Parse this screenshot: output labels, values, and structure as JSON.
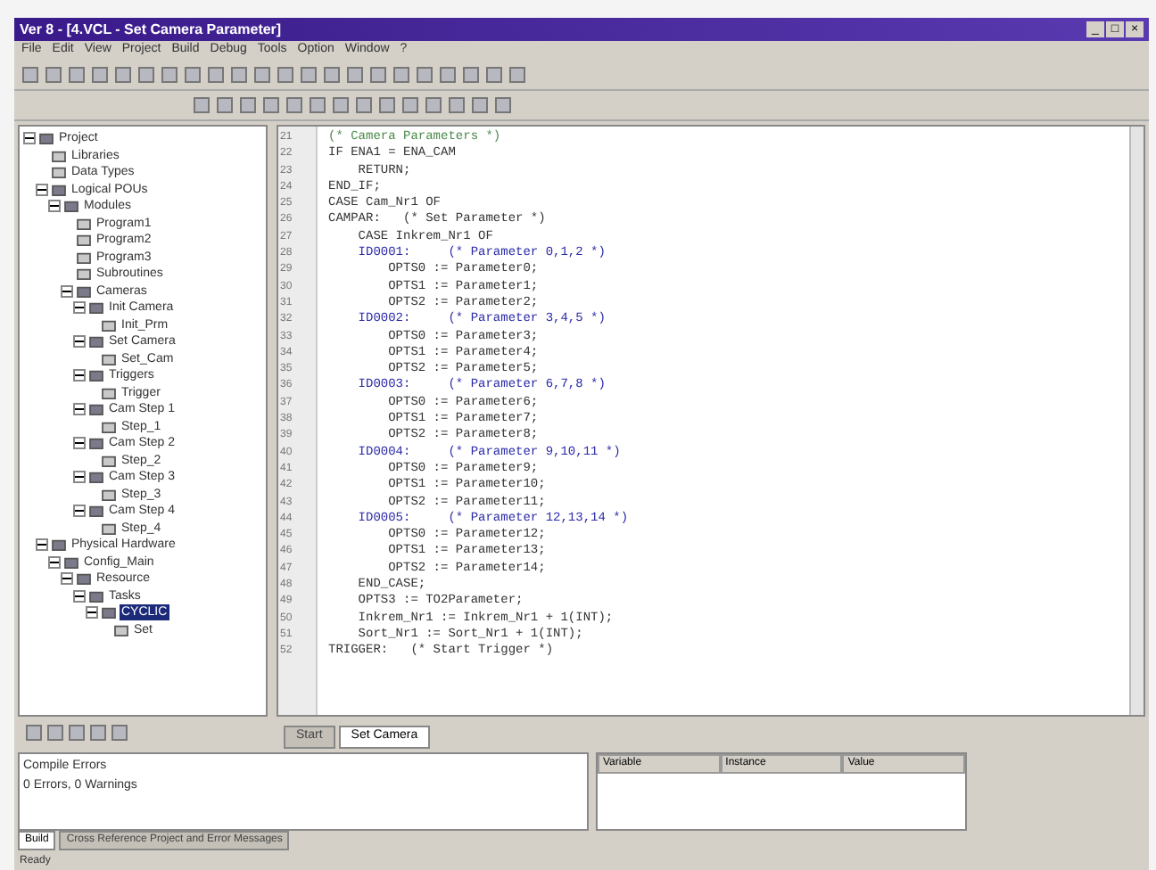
{
  "window": {
    "title": "Ver 8 - [4.VCL - Set Camera Parameter]",
    "controls": [
      "_",
      "□",
      "×"
    ]
  },
  "menu": [
    "File",
    "Edit",
    "View",
    "Project",
    "Build",
    "Debug",
    "Tools",
    "Option",
    "Window",
    "?"
  ],
  "tree": [
    {
      "label": "Project",
      "expanded": true,
      "children": [
        {
          "label": "Libraries"
        },
        {
          "label": "Data Types"
        },
        {
          "label": "Logical POUs",
          "expanded": true,
          "children": [
            {
              "label": "Modules",
              "expanded": true,
              "children": [
                {
                  "label": "Program1"
                },
                {
                  "label": "Program2"
                },
                {
                  "label": "Program3"
                },
                {
                  "label": "Subroutines"
                },
                {
                  "label": "Cameras",
                  "expanded": true,
                  "children": [
                    {
                      "label": "Init Camera",
                      "expanded": true,
                      "children": [
                        {
                          "label": "Init_Prm"
                        }
                      ]
                    },
                    {
                      "label": "Set Camera",
                      "expanded": true,
                      "children": [
                        {
                          "label": "Set_Cam"
                        }
                      ]
                    },
                    {
                      "label": "Triggers",
                      "expanded": true,
                      "children": [
                        {
                          "label": "Trigger"
                        }
                      ]
                    },
                    {
                      "label": "Cam Step 1",
                      "expanded": true,
                      "children": [
                        {
                          "label": "Step_1"
                        }
                      ]
                    },
                    {
                      "label": "Cam Step 2",
                      "expanded": true,
                      "children": [
                        {
                          "label": "Step_2"
                        }
                      ]
                    },
                    {
                      "label": "Cam Step 3",
                      "expanded": true,
                      "children": [
                        {
                          "label": "Step_3"
                        }
                      ]
                    },
                    {
                      "label": "Cam Step 4",
                      "expanded": true,
                      "children": [
                        {
                          "label": "Step_4"
                        }
                      ]
                    }
                  ]
                }
              ]
            }
          ]
        },
        {
          "label": "Physical Hardware",
          "expanded": true,
          "children": [
            {
              "label": "Config_Main",
              "expanded": true,
              "children": [
                {
                  "label": "Resource",
                  "expanded": true,
                  "children": [
                    {
                      "label": "Tasks",
                      "expanded": true,
                      "children": [
                        {
                          "label": "CYCLIC",
                          "selected": true,
                          "expanded": true,
                          "children": [
                            {
                              "label": "Set"
                            }
                          ]
                        }
                      ]
                    }
                  ]
                }
              ]
            }
          ]
        }
      ]
    }
  ],
  "editor": {
    "lines": [
      {
        "number": "21",
        "kind": "comment",
        "text": "(* Camera Parameters *)"
      },
      {
        "number": "22",
        "kind": "plain",
        "text": "IF ENA1 = ENA_CAM"
      },
      {
        "number": "23",
        "kind": "plain",
        "text": "    RETURN;"
      },
      {
        "number": "24",
        "kind": "plain",
        "text": "END_IF;"
      },
      {
        "number": "25",
        "kind": "plain",
        "text": "CASE Cam_Nr1 OF"
      },
      {
        "number": "26",
        "kind": "plain",
        "text": "CAMPAR:   (* Set Parameter *)"
      },
      {
        "number": "27",
        "kind": "plain",
        "text": "    CASE Inkrem_Nr1 OF"
      },
      {
        "number": "28",
        "kind": "keyword",
        "text": "    ID0001:     (* Parameter 0,1,2 *)"
      },
      {
        "number": "29",
        "kind": "plain",
        "text": "        OPTS0 := Parameter0;"
      },
      {
        "number": "30",
        "kind": "plain",
        "text": "        OPTS1 := Parameter1;"
      },
      {
        "number": "31",
        "kind": "plain",
        "text": "        OPTS2 := Parameter2;"
      },
      {
        "number": "32",
        "kind": "keyword",
        "text": "    ID0002:     (* Parameter 3,4,5 *)"
      },
      {
        "number": "33",
        "kind": "plain",
        "text": "        OPTS0 := Parameter3;"
      },
      {
        "number": "34",
        "kind": "plain",
        "text": "        OPTS1 := Parameter4;"
      },
      {
        "number": "35",
        "kind": "plain",
        "text": "        OPTS2 := Parameter5;"
      },
      {
        "number": "36",
        "kind": "keyword",
        "text": "    ID0003:     (* Parameter 6,7,8 *)"
      },
      {
        "number": "37",
        "kind": "plain",
        "text": "        OPTS0 := Parameter6;"
      },
      {
        "number": "38",
        "kind": "plain",
        "text": "        OPTS1 := Parameter7;"
      },
      {
        "number": "39",
        "kind": "plain",
        "text": "        OPTS2 := Parameter8;"
      },
      {
        "number": "40",
        "kind": "keyword",
        "text": "    ID0004:     (* Parameter 9,10,11 *)"
      },
      {
        "number": "41",
        "kind": "plain",
        "text": "        OPTS0 := Parameter9;"
      },
      {
        "number": "42",
        "kind": "plain",
        "text": "        OPTS1 := Parameter10;"
      },
      {
        "number": "43",
        "kind": "plain",
        "text": "        OPTS2 := Parameter11;"
      },
      {
        "number": "44",
        "kind": "keyword",
        "text": "    ID0005:     (* Parameter 12,13,14 *)"
      },
      {
        "number": "45",
        "kind": "plain",
        "text": "        OPTS0 := Parameter12;"
      },
      {
        "number": "46",
        "kind": "plain",
        "text": "        OPTS1 := Parameter13;"
      },
      {
        "number": "47",
        "kind": "plain",
        "text": "        OPTS2 := Parameter14;"
      },
      {
        "number": "48",
        "kind": "plain",
        "text": "    END_CASE;"
      },
      {
        "number": "49",
        "kind": "plain",
        "text": "    OPTS3 := TO2Parameter;"
      },
      {
        "number": "50",
        "kind": "plain",
        "text": "    Inkrem_Nr1 := Inkrem_Nr1 + 1(INT);"
      },
      {
        "number": "51",
        "kind": "plain",
        "text": "    Sort_Nr1 := Sort_Nr1 + 1(INT);"
      },
      {
        "number": "52",
        "kind": "plain",
        "text": "TRIGGER:   (* Start Trigger *)"
      }
    ]
  },
  "editor_tabs": [
    {
      "label": "Start",
      "selected": false
    },
    {
      "label": "Set Camera",
      "selected": true
    }
  ],
  "output": {
    "lines": [
      "Compile Errors",
      "0 Errors, 0 Warnings"
    ],
    "tabs": [
      {
        "label": "Build",
        "selected": true
      },
      {
        "label": "Cross Reference Project and Error Messages",
        "selected": false
      }
    ]
  },
  "watch": {
    "columns": [
      "Variable",
      "Instance",
      "Value"
    ]
  },
  "status_bar": "Ready"
}
